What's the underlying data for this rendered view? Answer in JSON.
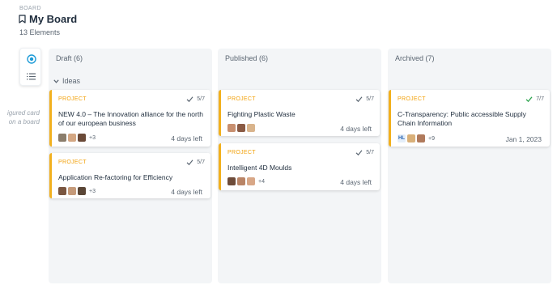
{
  "header": {
    "section_label": "BOARD",
    "title": "My Board",
    "count_text": "13 Elements"
  },
  "sidebar": {
    "ghost_text_line1": "igured card",
    "ghost_text_line2": "on a board"
  },
  "columns": [
    {
      "title": "Draft (6)"
    },
    {
      "title": "Published (6)"
    },
    {
      "title": "Archived (7)"
    }
  ],
  "groups": {
    "ideas": "Ideas"
  },
  "cards": [
    {
      "type": "PROJECT",
      "ratio": "5/7",
      "title": "NEW 4.0 – The Innovation alliance for the north of our european business",
      "more": "+3",
      "due": "4 days left"
    },
    {
      "type": "PROJECT",
      "ratio": "5/7",
      "title": "Application Re-factoring for Efficiency",
      "more": "+3",
      "due": "4 days left"
    },
    {
      "type": "PROJECT",
      "ratio": "5/7",
      "title": "Fighting Plastic Waste",
      "more": "",
      "due": "4 days left"
    },
    {
      "type": "PROJECT",
      "ratio": "5/7",
      "title": "Intelligent 4D Moulds",
      "more": "+4",
      "due": "4 days left"
    },
    {
      "type": "PROJECT",
      "ratio": "7/7",
      "title": "C-Transparency: Public accessible Supply Chain Information",
      "initials": "HL",
      "more": "+9",
      "due": "Jan 1, 2023"
    }
  ],
  "colors": {
    "accent": "#f2b01e",
    "project_label": "#f2a20c",
    "complete_check": "#2ea44f",
    "check_gray": "#5b6672",
    "active_view": "#1e9bd7"
  },
  "icons": [
    "bookmark-icon",
    "board-view-icon",
    "list-view-icon",
    "chevron-down-icon",
    "check-icon"
  ]
}
